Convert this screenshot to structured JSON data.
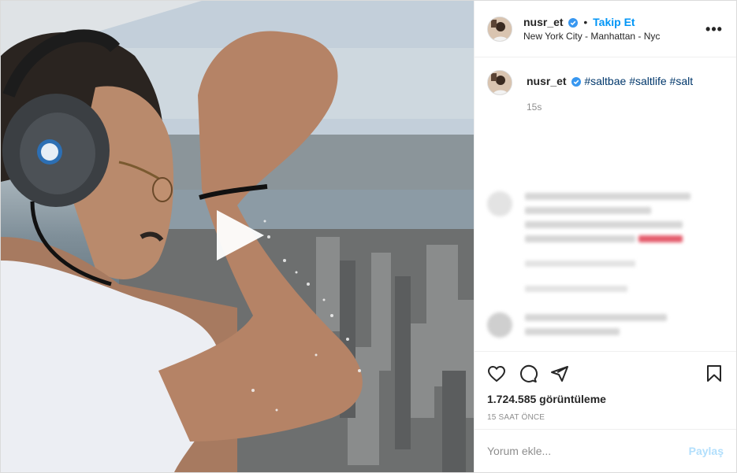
{
  "post": {
    "username": "nusr_et",
    "follow_label": "Takip Et",
    "separator": "•",
    "location": "New York City - Manhattan - Nyc",
    "more_label": "•••"
  },
  "caption": {
    "username": "nusr_et",
    "hashtags": [
      "#saltbae",
      "#saltlife",
      "#salt"
    ],
    "time": "15s"
  },
  "stats": {
    "views": "1.724.585 görüntüleme",
    "posted": "15 SAAT ÖNCE"
  },
  "comment_input": {
    "placeholder": "Yorum ekle...",
    "post_label": "Paylaş"
  },
  "colors": {
    "accent": "#0095f6",
    "hashtag": "#00376b",
    "muted": "#8e8e8e",
    "post_disabled": "#b2dffc"
  },
  "icons": [
    "play-icon",
    "verified-icon",
    "more-icon",
    "heart-icon",
    "comment-icon",
    "share-icon",
    "bookmark-icon"
  ]
}
